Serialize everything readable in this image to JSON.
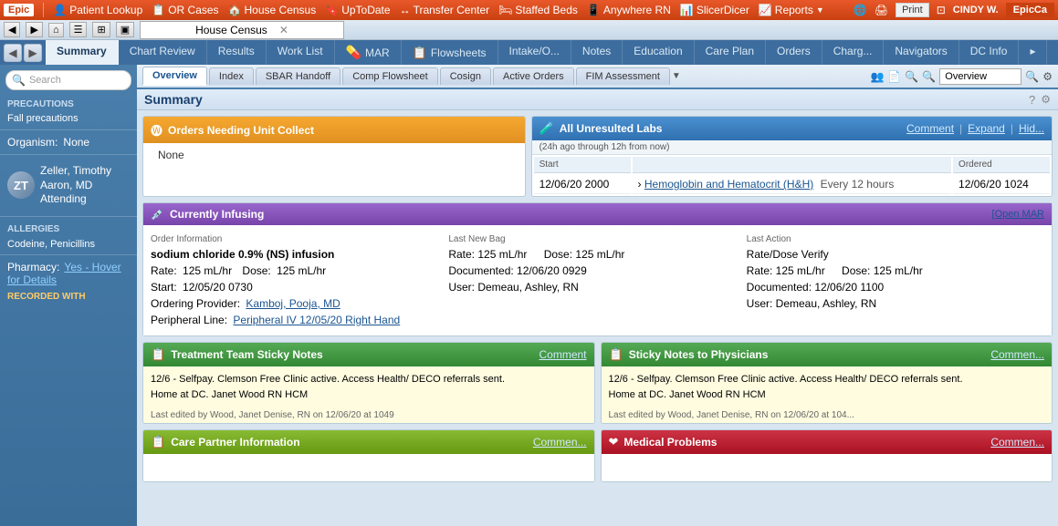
{
  "topbar": {
    "logo": "Epic",
    "nav_items": [
      {
        "label": "Patient Lookup",
        "icon": "👤"
      },
      {
        "label": "OR Cases",
        "icon": "📋"
      },
      {
        "label": "House Census",
        "icon": "🏠"
      },
      {
        "label": "UpToDate",
        "icon": "🔖"
      },
      {
        "label": "Transfer Center",
        "icon": "↔"
      },
      {
        "label": "Staffed Beds",
        "icon": "🛏"
      },
      {
        "label": "Anywhere RN",
        "icon": "📱"
      },
      {
        "label": "SlicerDicer",
        "icon": "📊"
      },
      {
        "label": "Reports",
        "icon": "📈"
      }
    ],
    "user": "CINDY W.",
    "print_label": "Print",
    "epic_label": "EpicCa"
  },
  "tabs": [
    {
      "label": "Summary",
      "active": true
    },
    {
      "label": "Chart Review"
    },
    {
      "label": "Results"
    },
    {
      "label": "Work List"
    },
    {
      "label": "MAR",
      "icon": "💊"
    },
    {
      "label": "Flowsheets",
      "icon": "📋"
    },
    {
      "label": "Intake/O..."
    },
    {
      "label": "Notes"
    },
    {
      "label": "Education"
    },
    {
      "label": "Care Plan"
    },
    {
      "label": "Orders"
    },
    {
      "label": "Charg..."
    },
    {
      "label": "Navigators"
    },
    {
      "label": "DC Info"
    }
  ],
  "sub_tabs": [
    {
      "label": "Overview",
      "active": true
    },
    {
      "label": "Index"
    },
    {
      "label": "SBAR Handoff"
    },
    {
      "label": "Comp Flowsheet"
    },
    {
      "label": "Cosign"
    },
    {
      "label": "Active Orders"
    },
    {
      "label": "FIM Assessment"
    }
  ],
  "page_title": "Summary",
  "breadcrumb": "House Census",
  "orders_card": {
    "title": "Orders Needing Unit Collect",
    "icon": "🅦",
    "value": "None"
  },
  "labs_card": {
    "title": "All Unresulted Labs",
    "subtitle": "(24h ago through 12h from now)",
    "comment_label": "Comment",
    "expand_label": "Expand",
    "hide_label": "Hid...",
    "columns": [
      "Start",
      "Ordered"
    ],
    "rows": [
      {
        "start": "12/06/20 2000",
        "arrow": "›",
        "test": "Hemoglobin and Hematocrit (H&H)",
        "frequency": "Every 12 hours",
        "ordered": "12/06/20 1024"
      }
    ]
  },
  "infusing_card": {
    "title": "Currently Infusing",
    "open_mar_label": "[Open MAR",
    "order_info_label": "Order Information",
    "drug_name": "sodium chloride 0.9% (NS) infusion",
    "rate_label": "Rate:",
    "rate_value": "125 mL/hr",
    "dose_label": "Dose:",
    "dose_value": "125 mL/hr",
    "start_label": "Start:",
    "start_value": "12/05/20 0730",
    "provider_label": "Ordering Provider:",
    "provider_value": "Kamboj, Pooja, MD",
    "line_label": "Peripheral Line:",
    "line_value": "Peripheral IV 12/05/20 Right Hand",
    "last_bag_label": "Last New Bag",
    "last_bag_rate": "Rate: 125 mL/hr",
    "last_bag_dose": "Dose: 125 mL/hr",
    "last_bag_documented": "Documented: 12/06/20 0929",
    "last_bag_user": "User: Demeau, Ashley, RN",
    "last_action_label": "Last Action",
    "last_action_type": "Rate/Dose Verify",
    "last_action_rate": "Rate: 125 mL/hr",
    "last_action_dose": "Dose: 125 mL/hr",
    "last_action_documented": "Documented: 12/06/20 1100",
    "last_action_user": "User: Demeau, Ashley, RN"
  },
  "treatment_sticky": {
    "title": "Treatment Team Sticky Notes",
    "comment_label": "Comment",
    "body": "12/6 - Selfpay.  Clemson Free Clinic active. Access Health/ DECO referrals sent.\nHome at DC.  Janet Wood RN HCM",
    "footer": "Last edited by Wood, Janet Denise, RN on 12/06/20 at 1049"
  },
  "physician_sticky": {
    "title": "Sticky Notes to Physicians",
    "comment_label": "Commen...",
    "body": "12/6 - Selfpay.  Clemson Free Clinic active. Access Health/ DECO referrals sent.\nHome at DC.  Janet Wood RN HCM",
    "footer": "Last edited by Wood, Janet Denise, RN on 12/06/20 at 104..."
  },
  "care_partner": {
    "title": "Care Partner Information",
    "comment_label": "Commen..."
  },
  "medical_problems": {
    "title": "Medical Problems",
    "icon": "❤",
    "comment_label": "Commen..."
  },
  "sidebar": {
    "search_placeholder": "Search",
    "precautions_label": "PRECAUTIONS",
    "precautions_value": "Fall precautions",
    "organism_label": "Organism:",
    "organism_value": "None",
    "provider_name": "Zeller, Timothy\nAaron, MD",
    "provider_role": "Attending",
    "provider_initials": "ZT",
    "allergies_label": "ALLERGIES",
    "allergies_value1": "Codeine, Penicillins",
    "pharmacy_label": "Pharmacy:",
    "pharmacy_value": "Yes - Hover for Details",
    "recorded_label": "RECORDED WITH"
  }
}
